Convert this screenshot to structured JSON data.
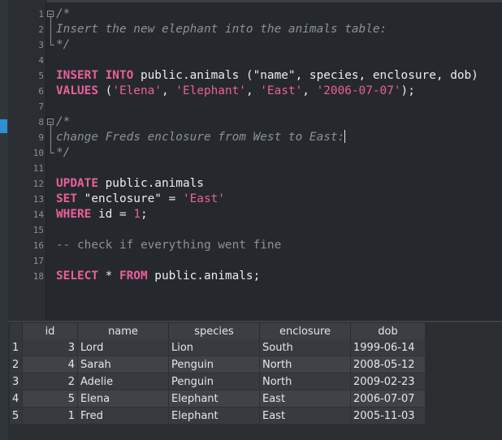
{
  "editor": {
    "line_numbers": [
      "1",
      "2",
      "3",
      "4",
      "5",
      "6",
      "7",
      "8",
      "9",
      "10",
      "11",
      "12",
      "13",
      "14",
      "15",
      "16",
      "17",
      "18"
    ],
    "l1": "/*",
    "l2": "Insert the new elephant into the animals table:",
    "l3": "*/",
    "l5_kw1": "INSERT INTO",
    "l5_rest": " public.animals (\"name\", species, enclosure, dob)",
    "l6_kw": "VALUES",
    "l6_p1": " (",
    "l6_s1": "'Elena'",
    "l6_c1": ", ",
    "l6_s2": "'Elephant'",
    "l6_c2": ", ",
    "l6_s3": "'East'",
    "l6_c3": ", ",
    "l6_s4": "'2006-07-07'",
    "l6_end": ");",
    "l8": "/*",
    "l9": "change Freds enclosure from West to East:",
    "l10": "*/",
    "l12_kw": "UPDATE",
    "l12_rest": " public.animals",
    "l13_kw": "SET",
    "l13_mid": " \"enclosure\" = ",
    "l13_str": "'East'",
    "l14_kw": "WHERE",
    "l14_mid": " id = ",
    "l14_num": "1",
    "l14_end": ";",
    "l16": "-- check if everything went fine",
    "l18_kw1": "SELECT",
    "l18_mid": " * ",
    "l18_kw2": "FROM",
    "l18_rest": " public.animals;"
  },
  "results": {
    "columns": [
      "id",
      "name",
      "species",
      "enclosure",
      "dob"
    ],
    "rows": [
      {
        "rn": "1",
        "id": "3",
        "name": "Lord",
        "species": "Lion",
        "enclosure": "South",
        "dob": "1999-06-14"
      },
      {
        "rn": "2",
        "id": "4",
        "name": "Sarah",
        "species": "Penguin",
        "enclosure": "North",
        "dob": "2008-05-12"
      },
      {
        "rn": "3",
        "id": "2",
        "name": "Adelie",
        "species": "Penguin",
        "enclosure": "North",
        "dob": "2009-02-23"
      },
      {
        "rn": "4",
        "id": "5",
        "name": "Elena",
        "species": "Elephant",
        "enclosure": "East",
        "dob": "2006-07-07"
      },
      {
        "rn": "5",
        "id": "1",
        "name": "Fred",
        "species": "Elephant",
        "enclosure": "East",
        "dob": "2005-11-03"
      }
    ]
  },
  "colors": {
    "keyword": "#ec5f9b",
    "comment": "#8b9196",
    "text": "#e6e6e6",
    "background": "#25292d",
    "accent": "#2f8fd6"
  }
}
